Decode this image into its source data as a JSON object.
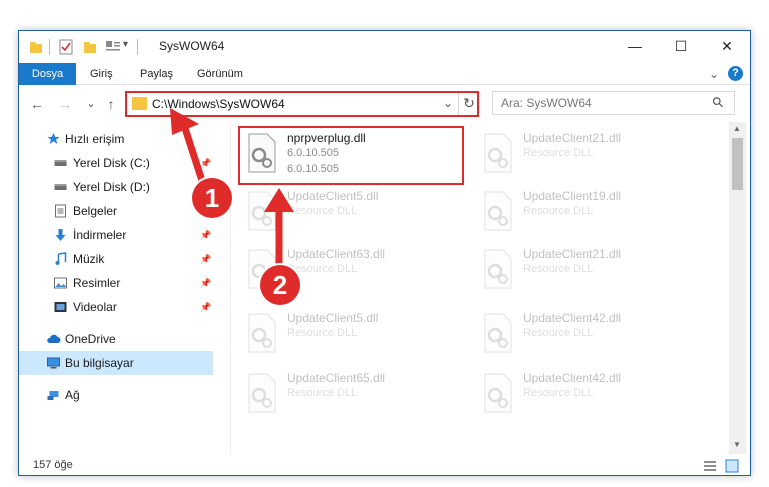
{
  "titlebar": {
    "title": "SysWOW64",
    "minimize": "—",
    "maximize": "☐",
    "close": "✕"
  },
  "ribbon": {
    "tabs": [
      "Dosya",
      "Giriş",
      "Paylaş",
      "Görünüm"
    ],
    "collapse": "⌄",
    "help": "?"
  },
  "nav": {
    "back": "←",
    "forward": "→",
    "recent": "⌄",
    "up": "↑",
    "address": "C:\\Windows\\SysWOW64",
    "address_dropdown": "⌄",
    "refresh": "↻",
    "search_placeholder": "Ara: SysWOW64",
    "search_icon": "⚲"
  },
  "sidebar": {
    "items": [
      {
        "label": "Hızlı erişim",
        "icon": "star-icon",
        "pinned": false
      },
      {
        "label": "Yerel Disk (C:)",
        "icon": "drive-icon",
        "pinned": true
      },
      {
        "label": "Yerel Disk (D:)",
        "icon": "drive-icon",
        "pinned": true
      },
      {
        "label": "Belgeler",
        "icon": "documents-icon",
        "pinned": true
      },
      {
        "label": "İndirmeler",
        "icon": "download-icon",
        "pinned": true
      },
      {
        "label": "Müzik",
        "icon": "music-icon",
        "pinned": true
      },
      {
        "label": "Resimler",
        "icon": "pictures-icon",
        "pinned": true
      },
      {
        "label": "Videolar",
        "icon": "videos-icon",
        "pinned": true
      },
      {
        "label": "OneDrive",
        "icon": "cloud-icon",
        "pinned": false
      },
      {
        "label": "Bu bilgisayar",
        "icon": "computer-icon",
        "pinned": false
      },
      {
        "label": "Ağ",
        "icon": "network-icon",
        "pinned": false
      }
    ],
    "pin_glyph": "📌"
  },
  "files": [
    {
      "name": "nprpverplug.dll",
      "line1": "6.0.10.505",
      "line2": "6.0.10.505",
      "faded": false
    },
    {
      "name": "UpdateClient21.dll",
      "line1": "Resource DLL",
      "faded": true
    },
    {
      "name": "UpdateClient5.dll",
      "line1": "Resource DLL",
      "faded": true
    },
    {
      "name": "UpdateClient19.dll",
      "line1": "Resource DLL",
      "faded": true
    },
    {
      "name": "UpdateClient63.dll",
      "line1": "Resource DLL",
      "faded": true
    },
    {
      "name": "UpdateClient21.dll",
      "line1": "Resource DLL",
      "faded": true
    },
    {
      "name": "UpdateClient5.dll",
      "line1": "Resource DLL",
      "faded": true
    },
    {
      "name": "UpdateClient42.dll",
      "line1": "Resource DLL",
      "faded": true
    },
    {
      "name": "UpdateClient65.dll",
      "line1": "Resource DLL",
      "faded": true
    },
    {
      "name": "UpdateClient42.dll",
      "line1": "Resource DLL",
      "faded": true
    }
  ],
  "status": {
    "count": "157 öğe"
  },
  "annotations": {
    "step1": "1",
    "step2": "2"
  },
  "colors": {
    "accent": "#1979ca",
    "highlight": "#e02b2b",
    "selected": "#cce8ff"
  }
}
